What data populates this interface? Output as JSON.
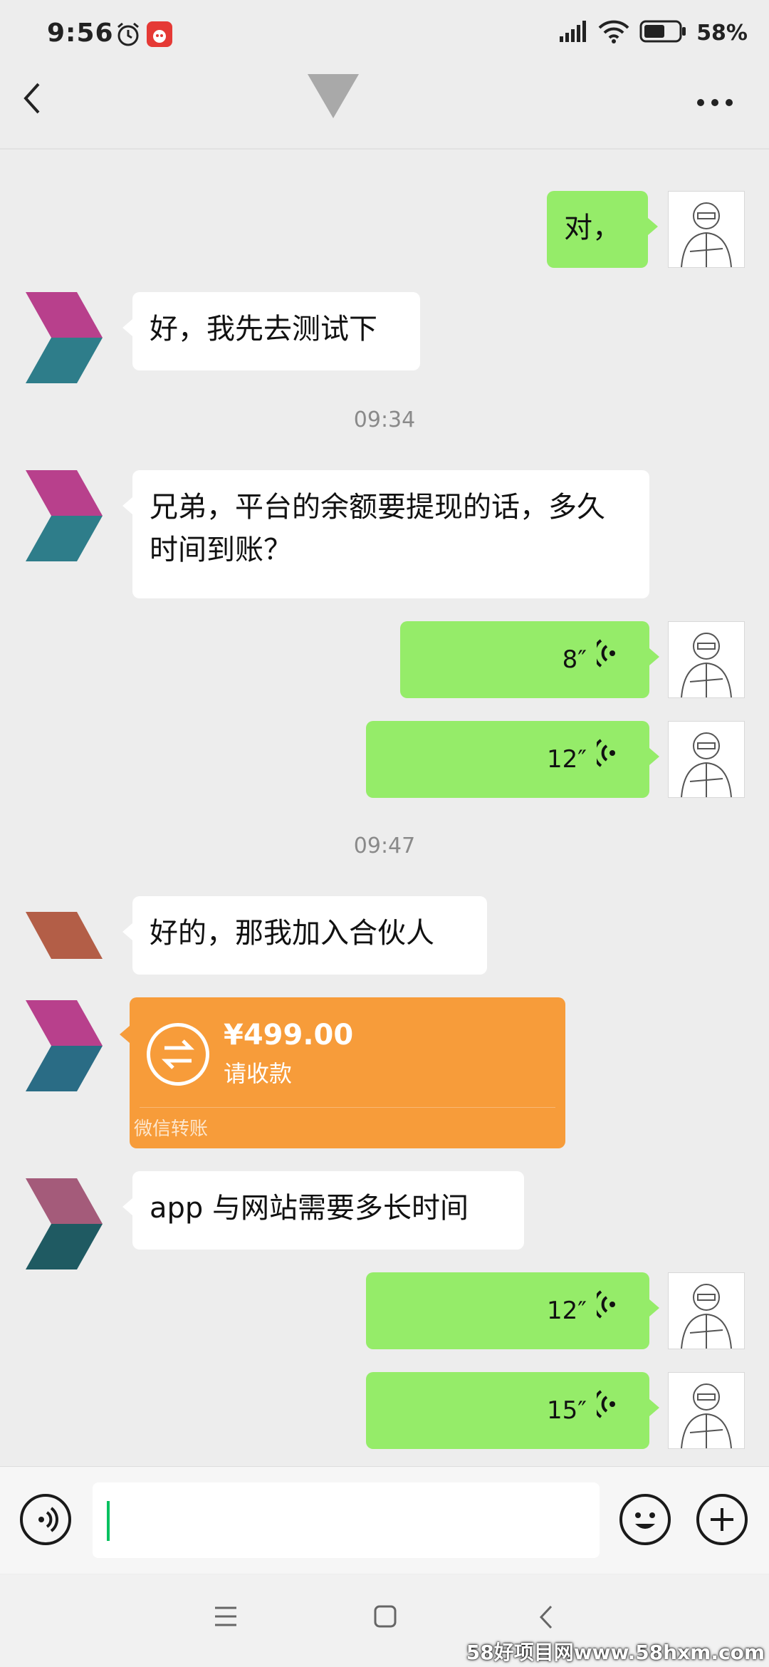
{
  "status_bar": {
    "time": "9:56",
    "battery": "58%"
  },
  "header": {},
  "messages": [
    {
      "side": "right",
      "type": "text",
      "text": "对，"
    },
    {
      "side": "left",
      "type": "text",
      "text": "好，我先去测试下"
    },
    {
      "type": "time",
      "text": "09:34"
    },
    {
      "side": "left",
      "type": "text",
      "text": "兄弟，平台的余额要提现的话，多久时间到账？"
    },
    {
      "side": "right",
      "type": "voice",
      "duration": "8″"
    },
    {
      "side": "right",
      "type": "voice",
      "duration": "12″"
    },
    {
      "type": "time",
      "text": "09:47"
    },
    {
      "side": "left",
      "type": "text",
      "text": "好的，那我加入合伙人"
    },
    {
      "side": "left",
      "type": "transfer",
      "amount": "¥499.00",
      "status": "请收款",
      "footer": "微信转账"
    },
    {
      "side": "left",
      "type": "text",
      "text": "app 与网站需要多长时间"
    },
    {
      "side": "right",
      "type": "voice",
      "duration": "12″"
    },
    {
      "side": "right",
      "type": "voice",
      "duration": "15″"
    }
  ],
  "input": {
    "value": ""
  },
  "watermark": "58好项目网www.58hxm.com",
  "colors": {
    "sent_bubble": "#95ec69",
    "received_bubble": "#ffffff",
    "transfer": "#f79c3a",
    "background": "#ededed"
  }
}
